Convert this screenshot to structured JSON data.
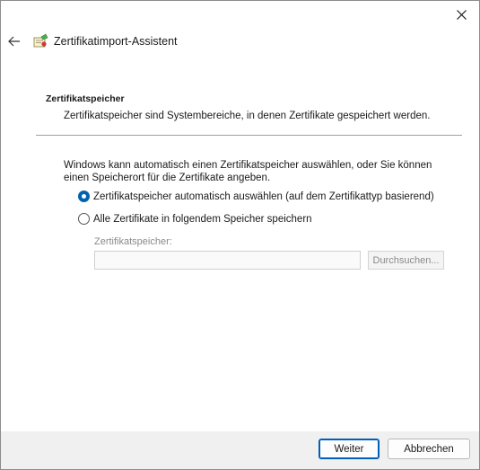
{
  "window": {
    "title": "Zertifikatimport-Assistent",
    "close_icon": "close-icon",
    "back_icon": "back-arrow-icon",
    "app_icon": "certificate-wizard-icon"
  },
  "section": {
    "heading": "Zertifikatspeicher",
    "description": "Zertifikatspeicher sind Systembereiche, in denen Zertifikate gespeichert werden."
  },
  "intro": "Windows kann automatisch einen Zertifikatspeicher auswählen, oder Sie können einen Speicherort für die Zertifikate angeben.",
  "options": [
    {
      "label": "Zertifikatspeicher automatisch auswählen (auf dem Zertifikattyp basierend)",
      "checked": true
    },
    {
      "label": "Alle Zertifikate in folgendem Speicher speichern",
      "checked": false
    }
  ],
  "store": {
    "label": "Zertifikatspeicher:",
    "value": "",
    "browse_label": "Durchsuchen..."
  },
  "footer": {
    "next_label": "Weiter",
    "cancel_label": "Abbrechen"
  },
  "colors": {
    "accent": "#0063b1"
  }
}
